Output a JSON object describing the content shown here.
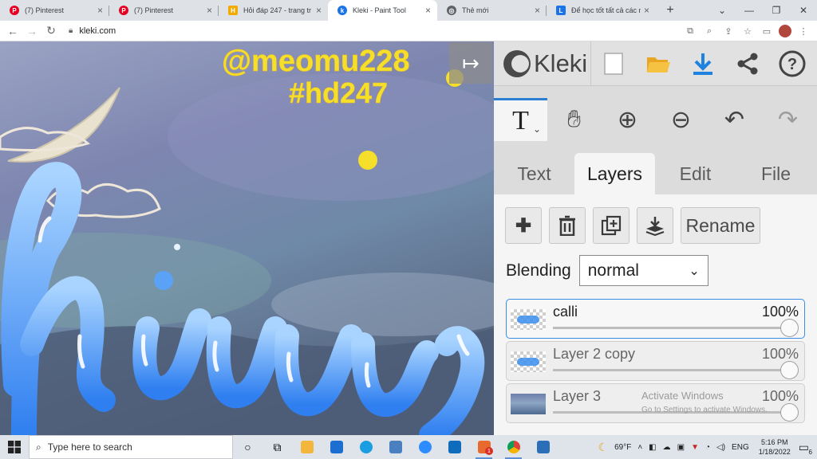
{
  "browser": {
    "tabs": [
      {
        "label": "(7) Pinterest",
        "icon": "pinterest-icon",
        "color": "#e60023",
        "active": false
      },
      {
        "label": "(7) Pinterest",
        "icon": "pinterest-icon",
        "color": "#e60023",
        "active": false
      },
      {
        "label": "Hỏi đáp 247 - trang tr",
        "icon": "hoidap-icon",
        "color": "#f2a900",
        "active": false
      },
      {
        "label": "Kleki - Paint Tool",
        "icon": "kleki-icon",
        "color": "#1a73e8",
        "active": true
      },
      {
        "label": "Thẻ mới",
        "icon": "chrome-icon",
        "color": "#5f6368",
        "active": false
      },
      {
        "label": "Để học tốt tất cả các n",
        "icon": "loigiai-icon",
        "color": "#1a73e8",
        "active": false
      }
    ],
    "url": "kleki.com"
  },
  "canvas": {
    "watermark_line1": "@meomu228",
    "watermark_line2": "#hd247",
    "watermark_color": "#f6df2b"
  },
  "panel": {
    "logo_text": "Kleki",
    "tool_text_glyph": "T",
    "tabs": [
      "Text",
      "Layers",
      "Edit",
      "File"
    ],
    "active_tab": "Layers",
    "rename_label": "Rename",
    "blending_label": "Blending",
    "blending_value": "normal",
    "layers": [
      {
        "name": "calli",
        "opacity": "100%",
        "active": true
      },
      {
        "name": "Layer 2 copy",
        "opacity": "100%",
        "active": false
      },
      {
        "name": "Layer 3",
        "opacity": "100%",
        "active": false
      }
    ],
    "accent_color": "#2a7fd4"
  },
  "windows": {
    "activate_title": "Activate Windows",
    "activate_sub": "Go to Settings to activate Windows."
  },
  "taskbar": {
    "search_placeholder": "Type here to search",
    "weather": "69°F",
    "language": "ENG",
    "time": "5:16 PM",
    "date": "1/18/2022",
    "notification_count": "6",
    "app_badge": "1"
  }
}
